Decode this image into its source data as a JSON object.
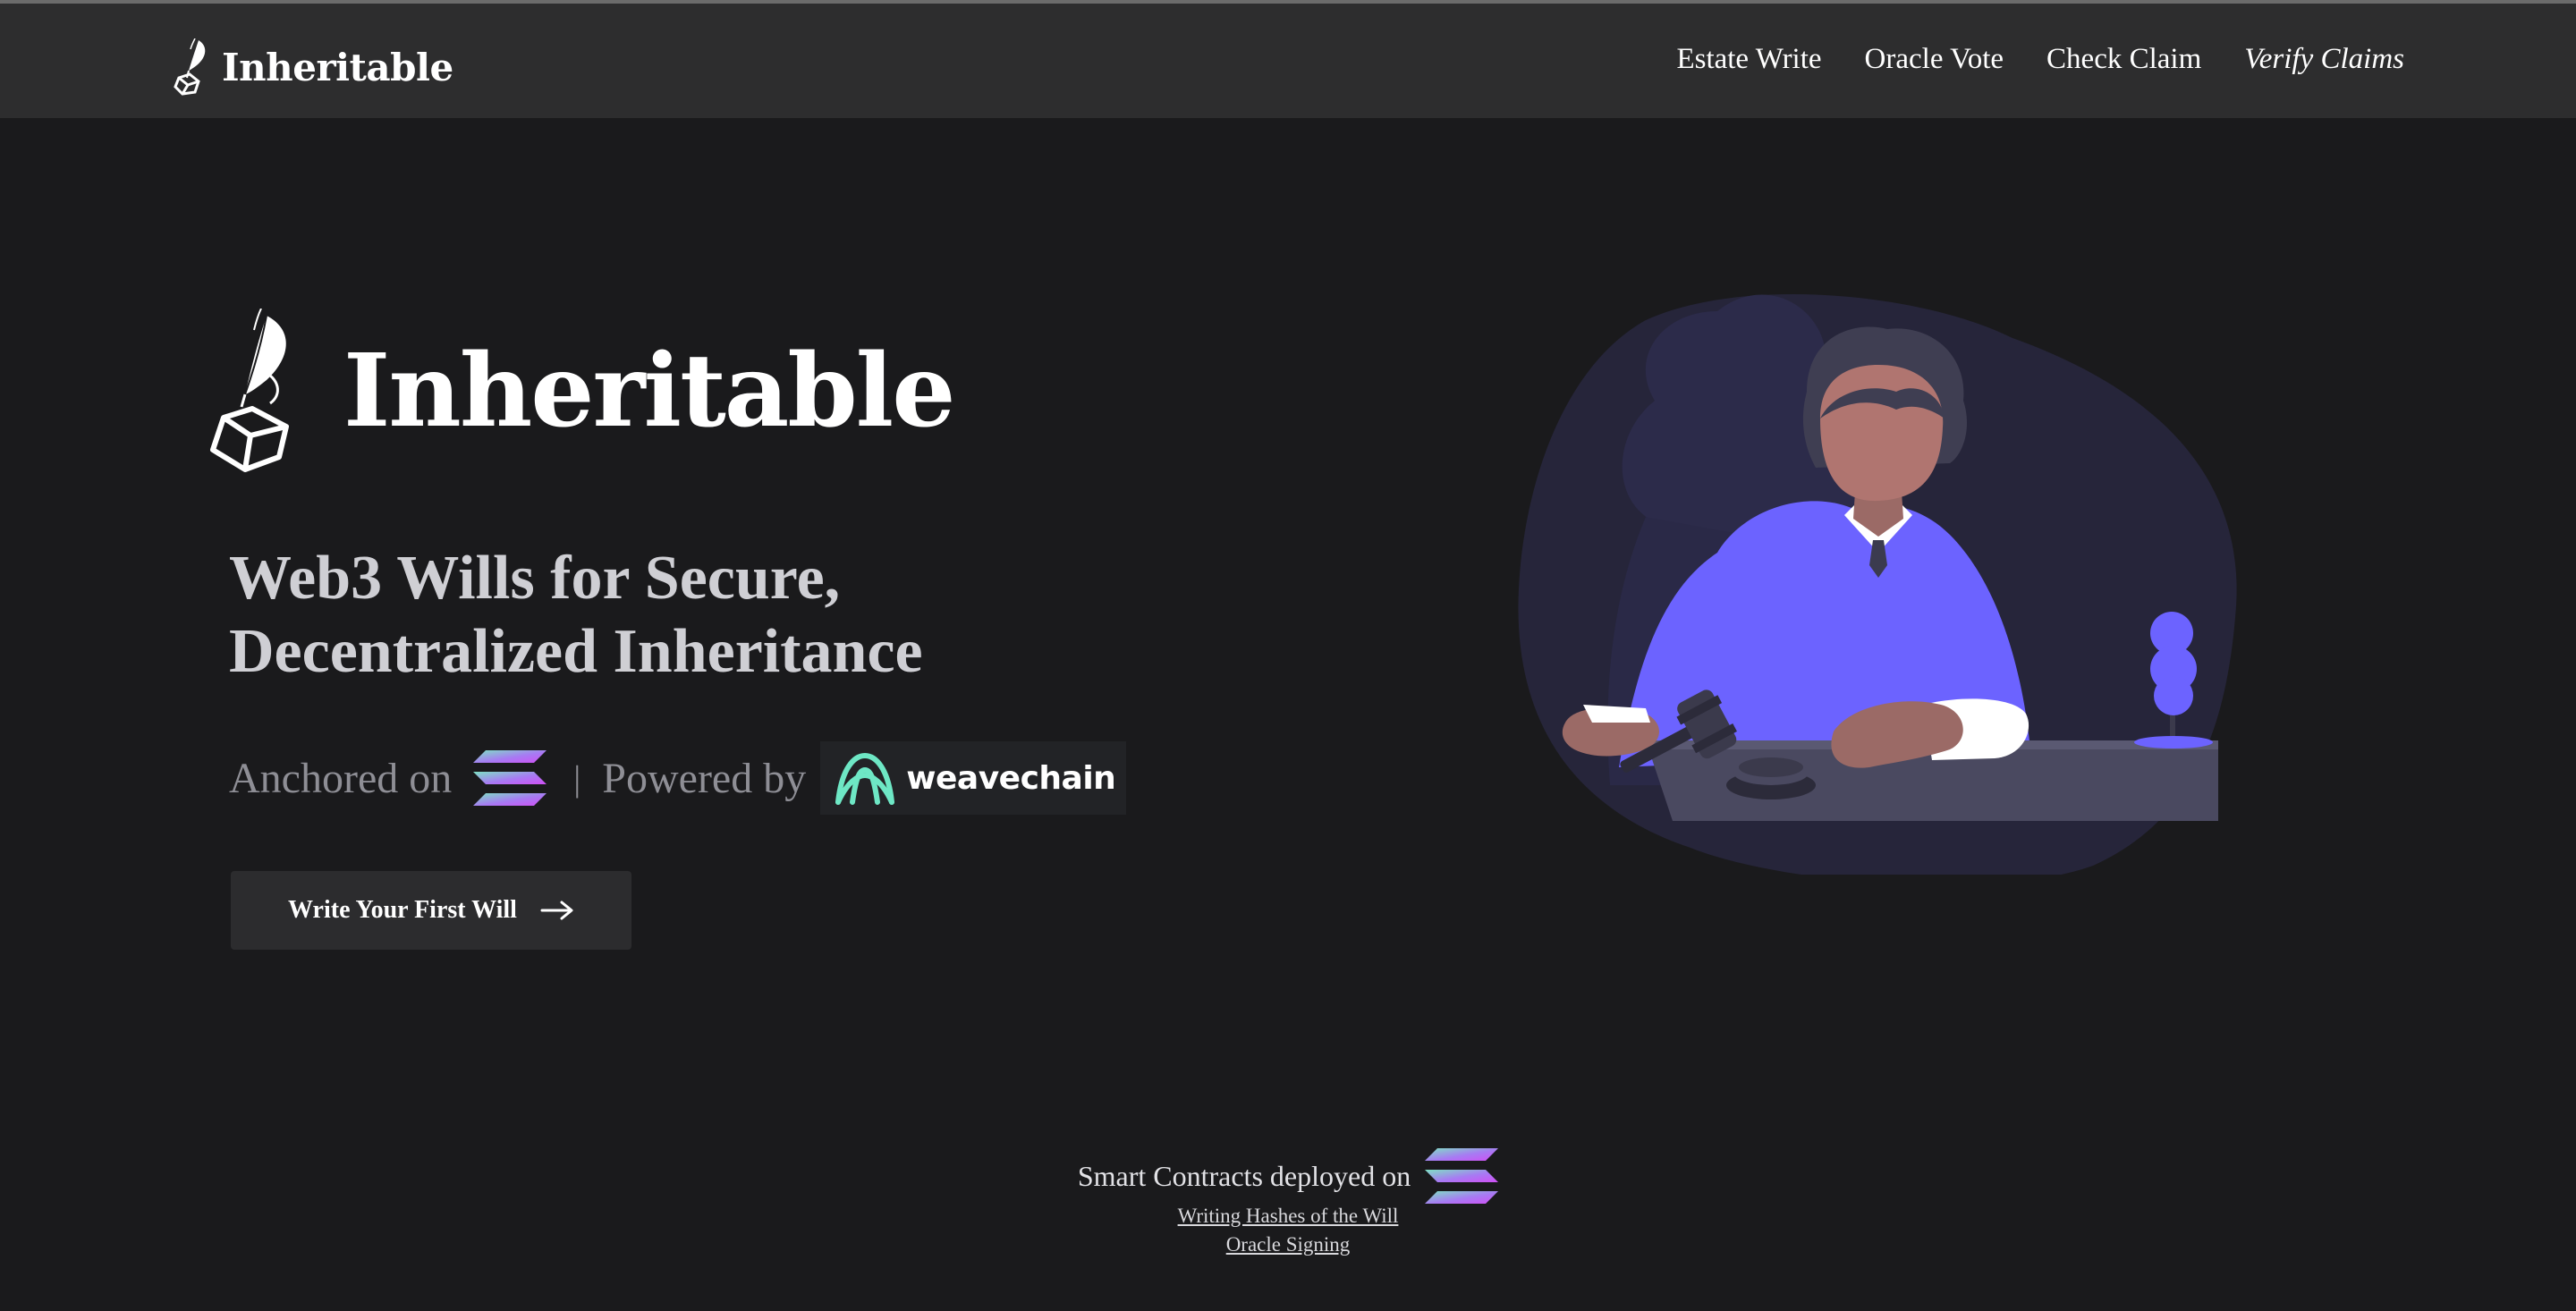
{
  "brand": {
    "name": "Inheritable",
    "logo_icon": "quill-cube-icon"
  },
  "nav": {
    "items": [
      {
        "label": "Estate Write",
        "italic": false
      },
      {
        "label": "Oracle Vote",
        "italic": false
      },
      {
        "label": "Check Claim",
        "italic": false
      },
      {
        "label": "Verify Claims",
        "italic": true
      }
    ]
  },
  "hero": {
    "title": "Inheritable",
    "subtitle_line1": "Web3 Wills for Secure,",
    "subtitle_line2": "Decentralized Inheritance",
    "anchored_label": "Anchored on",
    "anchored_icon": "solana-logo-icon",
    "separator": "|",
    "powered_label": "Powered by",
    "powered_brand": "weavechain",
    "powered_icon": "weavechain-logo-icon",
    "cta_label": "Write Your First Will",
    "cta_icon": "arrow-right-icon",
    "illustration": "judge-at-bench-illustration"
  },
  "footer": {
    "deployed_label": "Smart Contracts deployed on",
    "deployed_icon": "solana-logo-icon",
    "links": [
      "Writing Hashes of the Will",
      "Oracle Signing"
    ]
  },
  "colors": {
    "background": "#1a1a1c",
    "navbar": "#2d2d2e",
    "accent_purple": "#6c63ff",
    "weavechain_green": "#6ee7c5",
    "solana_gradient": [
      "#7ee2c4",
      "#a77bf3",
      "#d14ff5"
    ]
  }
}
